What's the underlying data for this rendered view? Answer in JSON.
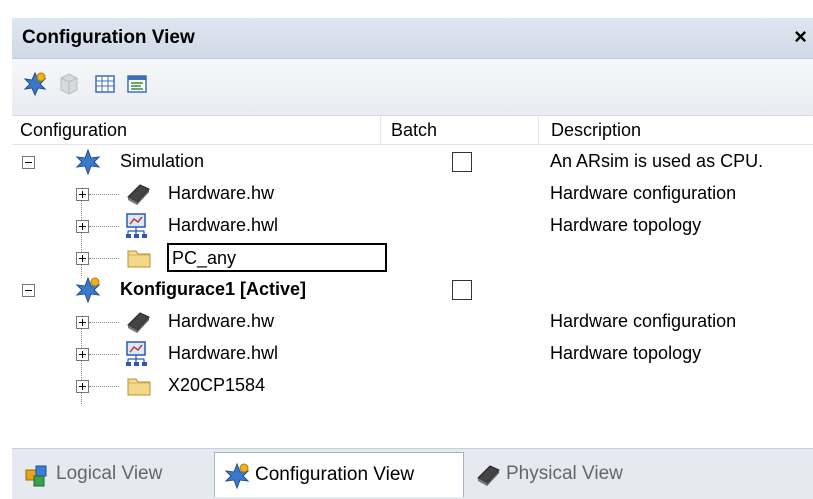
{
  "window": {
    "title": "Configuration View",
    "close_label": "×"
  },
  "toolbar": {
    "buttons": [
      "activate-configuration-icon",
      "disabled-cube-icon",
      "table-view-icon",
      "properties-icon"
    ]
  },
  "columns": {
    "configuration": "Configuration",
    "batch": "Batch",
    "description": "Description"
  },
  "tree": {
    "simulation": {
      "label": "Simulation",
      "description": "An ARsim is used as CPU.",
      "batch_checked": false,
      "children": [
        {
          "label": "Hardware.hw",
          "description": "Hardware configuration",
          "icon": "hardware-icon"
        },
        {
          "label": "Hardware.hwl",
          "description": "Hardware topology",
          "icon": "topology-icon"
        },
        {
          "label": "PC_any",
          "description": "",
          "icon": "folder-icon",
          "editing": true
        }
      ]
    },
    "konfigurace": {
      "label": "Konfigurace1 [Active]",
      "description": "",
      "batch_checked": false,
      "children": [
        {
          "label": "Hardware.hw",
          "description": "Hardware configuration",
          "icon": "hardware-icon"
        },
        {
          "label": "Hardware.hwl",
          "description": "Hardware topology",
          "icon": "topology-icon"
        },
        {
          "label": "X20CP1584",
          "description": "",
          "icon": "folder-icon"
        }
      ]
    }
  },
  "tabs": [
    {
      "label": "Logical View",
      "icon": "logical-view-icon",
      "active": false
    },
    {
      "label": "Configuration View",
      "icon": "configuration-icon",
      "active": true
    },
    {
      "label": "Physical View",
      "icon": "physical-view-icon",
      "active": false
    }
  ]
}
